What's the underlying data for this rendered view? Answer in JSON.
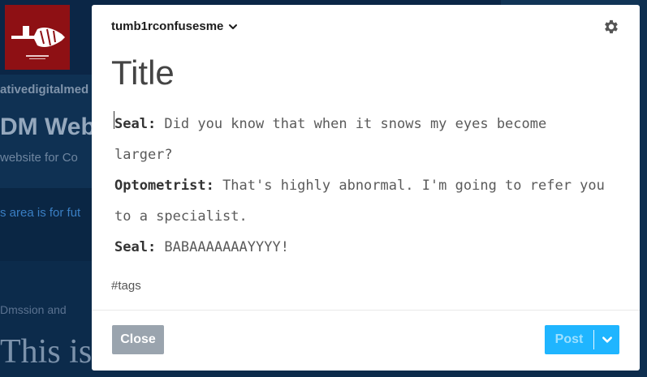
{
  "background": {
    "line1": "ativedigitalmed",
    "line2": "DM Web",
    "line3": "website for Co",
    "line4": "s area is for fut",
    "line5": "Dmssion and",
    "line6": "This is"
  },
  "composer": {
    "blog_name": "tumb1rconfusesme",
    "title_placeholder": "Title",
    "body": [
      {
        "speaker": "Seal:",
        "text": " Did you know that when it snows my eyes become"
      },
      {
        "speaker": "",
        "text": "larger?"
      },
      {
        "speaker": "Optometrist:",
        "text": " That's highly abnormal. I'm going to refer you"
      },
      {
        "speaker": "",
        "text": "to a specialist."
      },
      {
        "speaker": "Seal:",
        "text": " BABAAAAAAAYYYY!"
      }
    ],
    "tags_placeholder": "#tags",
    "close_label": "Close",
    "post_label": "Post"
  },
  "colors": {
    "post_button": "#1fb5ff",
    "close_button": "#9aa4ae",
    "overlay": "#0d2c4d",
    "avatar": "#8e1014"
  },
  "icons": {
    "blog_dropdown": "chevron-down-icon",
    "settings": "gear-icon",
    "post_options": "chevron-down-icon"
  }
}
